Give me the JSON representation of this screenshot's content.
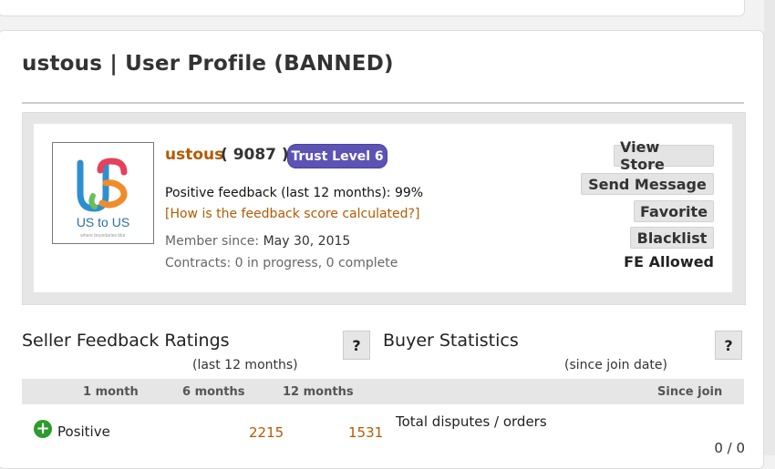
{
  "page": {
    "title": "ustous | User Profile (BANNED)"
  },
  "profile": {
    "username": "ustous",
    "rating_text": "( 9087 )",
    "trust_level": "Trust Level 6",
    "positive_feedback": "Positive feedback (last 12 months): 99%",
    "feedback_link": "[How is the feedback score calculated?]",
    "member_since_label": "Member since:",
    "member_since_value": "May 30, 2015",
    "contracts": "Contracts: 0 in progress, 0 complete",
    "logo_text": "US to US",
    "logo_tagline": "where boundaries blur"
  },
  "actions": {
    "view_store": "View Store",
    "send_message": "Send Message",
    "favorite": "Favorite",
    "blacklist": "Blacklist",
    "fe_allowed": "FE Allowed"
  },
  "seller_feedback": {
    "title": "Seller Feedback Ratings",
    "help": "?",
    "subtitle": "(last 12 months)",
    "columns": [
      "1 month",
      "6 months",
      "12 months"
    ],
    "rows": [
      {
        "label": "Positive",
        "values": [
          "",
          "2215",
          "1531"
        ]
      }
    ]
  },
  "buyer_stats": {
    "title": "Buyer Statistics",
    "help": "?",
    "subtitle": "(since join date)",
    "column": "Since join",
    "rows": [
      {
        "label": "Total disputes / orders",
        "value": "0 / 0"
      }
    ]
  },
  "colors": {
    "accent_orange": "#b35a00",
    "trust_badge": "#5d53b5",
    "positive_green": "#2a9d2a"
  },
  "icons": {
    "positive": "plus-circle-icon",
    "help": "question-mark-icon"
  }
}
